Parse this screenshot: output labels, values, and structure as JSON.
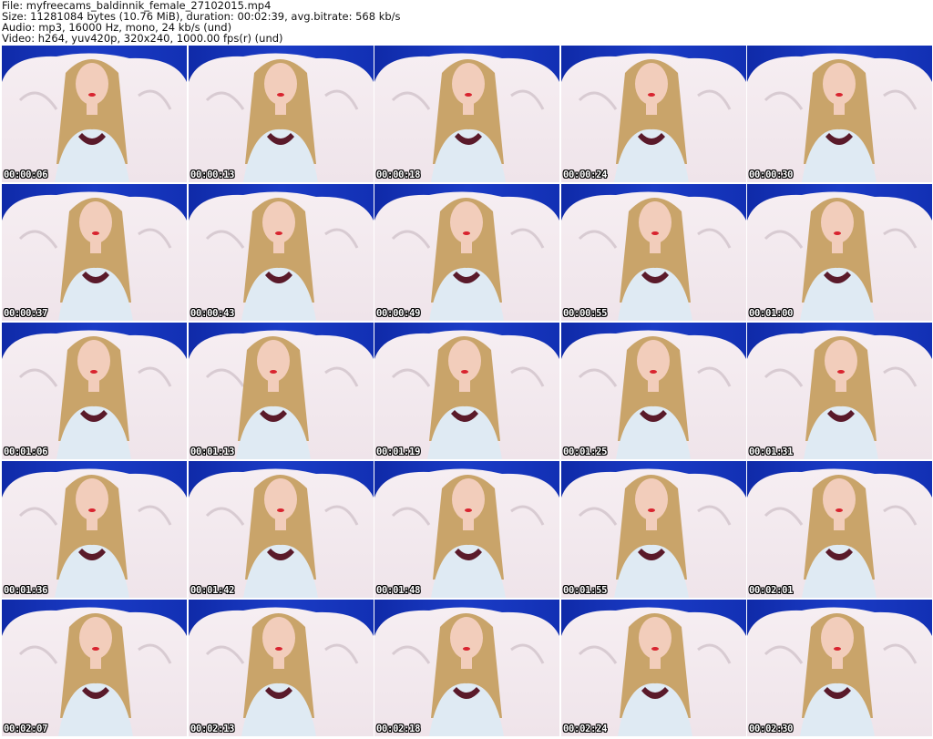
{
  "header": {
    "file_line": "File: myfreecams_baldinnik_female_27102015.mp4",
    "size_line": "Size: 11281084 bytes (10.76 MiB), duration: 00:02:39, avg.bitrate: 568 kb/s",
    "audio_line": "Audio: mp3, 16000 Hz, mono, 24 kb/s (und)",
    "video_line": "Video: h264, yuv420p, 320x240, 1000.00 fps(r) (und)"
  },
  "colors": {
    "background": "#ffffff",
    "curtain": "#1b3cc6",
    "pillow": "#efe4ea",
    "hair": "#c9a46a",
    "skin": "#f2cdbb",
    "top": "#dfeaf3",
    "timestamp_text": "#ffffff"
  },
  "thumbnails": [
    {
      "timestamp": "00:00:06"
    },
    {
      "timestamp": "00:00:13"
    },
    {
      "timestamp": "00:00:18"
    },
    {
      "timestamp": "00:00:24"
    },
    {
      "timestamp": "00:00:30"
    },
    {
      "timestamp": "00:00:37"
    },
    {
      "timestamp": "00:00:43"
    },
    {
      "timestamp": "00:00:49"
    },
    {
      "timestamp": "00:00:55"
    },
    {
      "timestamp": "00:01:00"
    },
    {
      "timestamp": "00:01:06"
    },
    {
      "timestamp": "00:01:13"
    },
    {
      "timestamp": "00:01:19"
    },
    {
      "timestamp": "00:01:25"
    },
    {
      "timestamp": "00:01:31"
    },
    {
      "timestamp": "00:01:36"
    },
    {
      "timestamp": "00:01:42"
    },
    {
      "timestamp": "00:01:48"
    },
    {
      "timestamp": "00:01:55"
    },
    {
      "timestamp": "00:02:01"
    },
    {
      "timestamp": "00:02:07"
    },
    {
      "timestamp": "00:02:13"
    },
    {
      "timestamp": "00:02:18"
    },
    {
      "timestamp": "00:02:24"
    },
    {
      "timestamp": "00:02:30"
    }
  ]
}
